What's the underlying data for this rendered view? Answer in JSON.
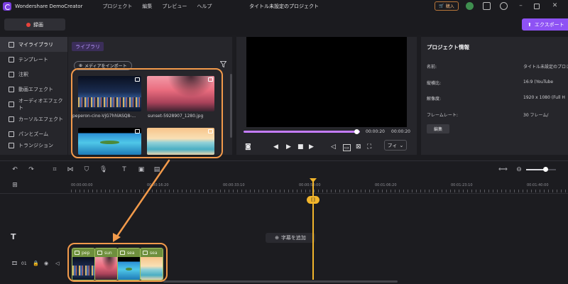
{
  "app": {
    "name": "Wondershare DemoCreator",
    "project_title": "タイトル未設定のプロジェクト",
    "menu": [
      "プロジェクト",
      "編集",
      "プレビュー",
      "ヘルプ"
    ],
    "buy_label": "購入"
  },
  "toolbar": {
    "record_label": "録画",
    "export_label": "エクスポート"
  },
  "sidebar": {
    "items": [
      {
        "label": "マイライブラリ",
        "icon": "layers-icon",
        "active": true
      },
      {
        "label": "テンプレート",
        "icon": "template-icon"
      },
      {
        "label": "注釈",
        "icon": "annotation-icon"
      },
      {
        "label": "動画エフェクト",
        "icon": "video-effect-icon"
      },
      {
        "label": "オーディオエフェクト",
        "icon": "audio-effect-icon"
      },
      {
        "label": "カーソルエフェクト",
        "icon": "cursor-effect-icon"
      },
      {
        "label": "パンとズーム",
        "icon": "pan-zoom-icon"
      },
      {
        "label": "トランジション",
        "icon": "transition-icon"
      }
    ]
  },
  "library": {
    "tab_label": "ライブラリ",
    "import_label": "メディアをインポート",
    "media": [
      {
        "name": "peperon-cino-VjG7hhlASQ8-...",
        "kind": "city"
      },
      {
        "name": "sunset-5928907_1280.jpg",
        "kind": "sunset"
      },
      {
        "name": "",
        "kind": "island"
      },
      {
        "name": "",
        "kind": "beach"
      }
    ]
  },
  "preview": {
    "current_time": "00:00:20",
    "total_time": "00:00:20",
    "progress": 0.98,
    "fit_label": "フィ"
  },
  "project_info": {
    "title": "プロジェクト情報",
    "rows": [
      {
        "key": "名前:",
        "value": "タイトル未設定のプロジェクト"
      },
      {
        "key": "縦横比:",
        "value": "16:9 (YouTube"
      },
      {
        "key": "解像度:",
        "value": "1920 x 1080 (Full H"
      },
      {
        "key": "フレームレート:",
        "value": "30 フレーム/"
      }
    ],
    "edit_label": "編集"
  },
  "timeline": {
    "ticks": [
      "00:00:00:00",
      "00:00:16:20",
      "00:00:33:10",
      "00:00:50:00",
      "00:01:06:20",
      "00:01:23:10",
      "00:01:40:00"
    ],
    "add_subtitle_label": "字幕を追加",
    "track_number": "01",
    "clips": [
      {
        "label": "pep",
        "kind": "city"
      },
      {
        "label": "sun",
        "kind": "sunset"
      },
      {
        "label": "sea",
        "kind": "island"
      },
      {
        "label": "sea",
        "kind": "beach"
      }
    ]
  },
  "colors": {
    "accent": "#8e52f4",
    "annotation": "#f29a4b",
    "playhead": "#f2b52b",
    "clip": "#6e8f3d"
  }
}
